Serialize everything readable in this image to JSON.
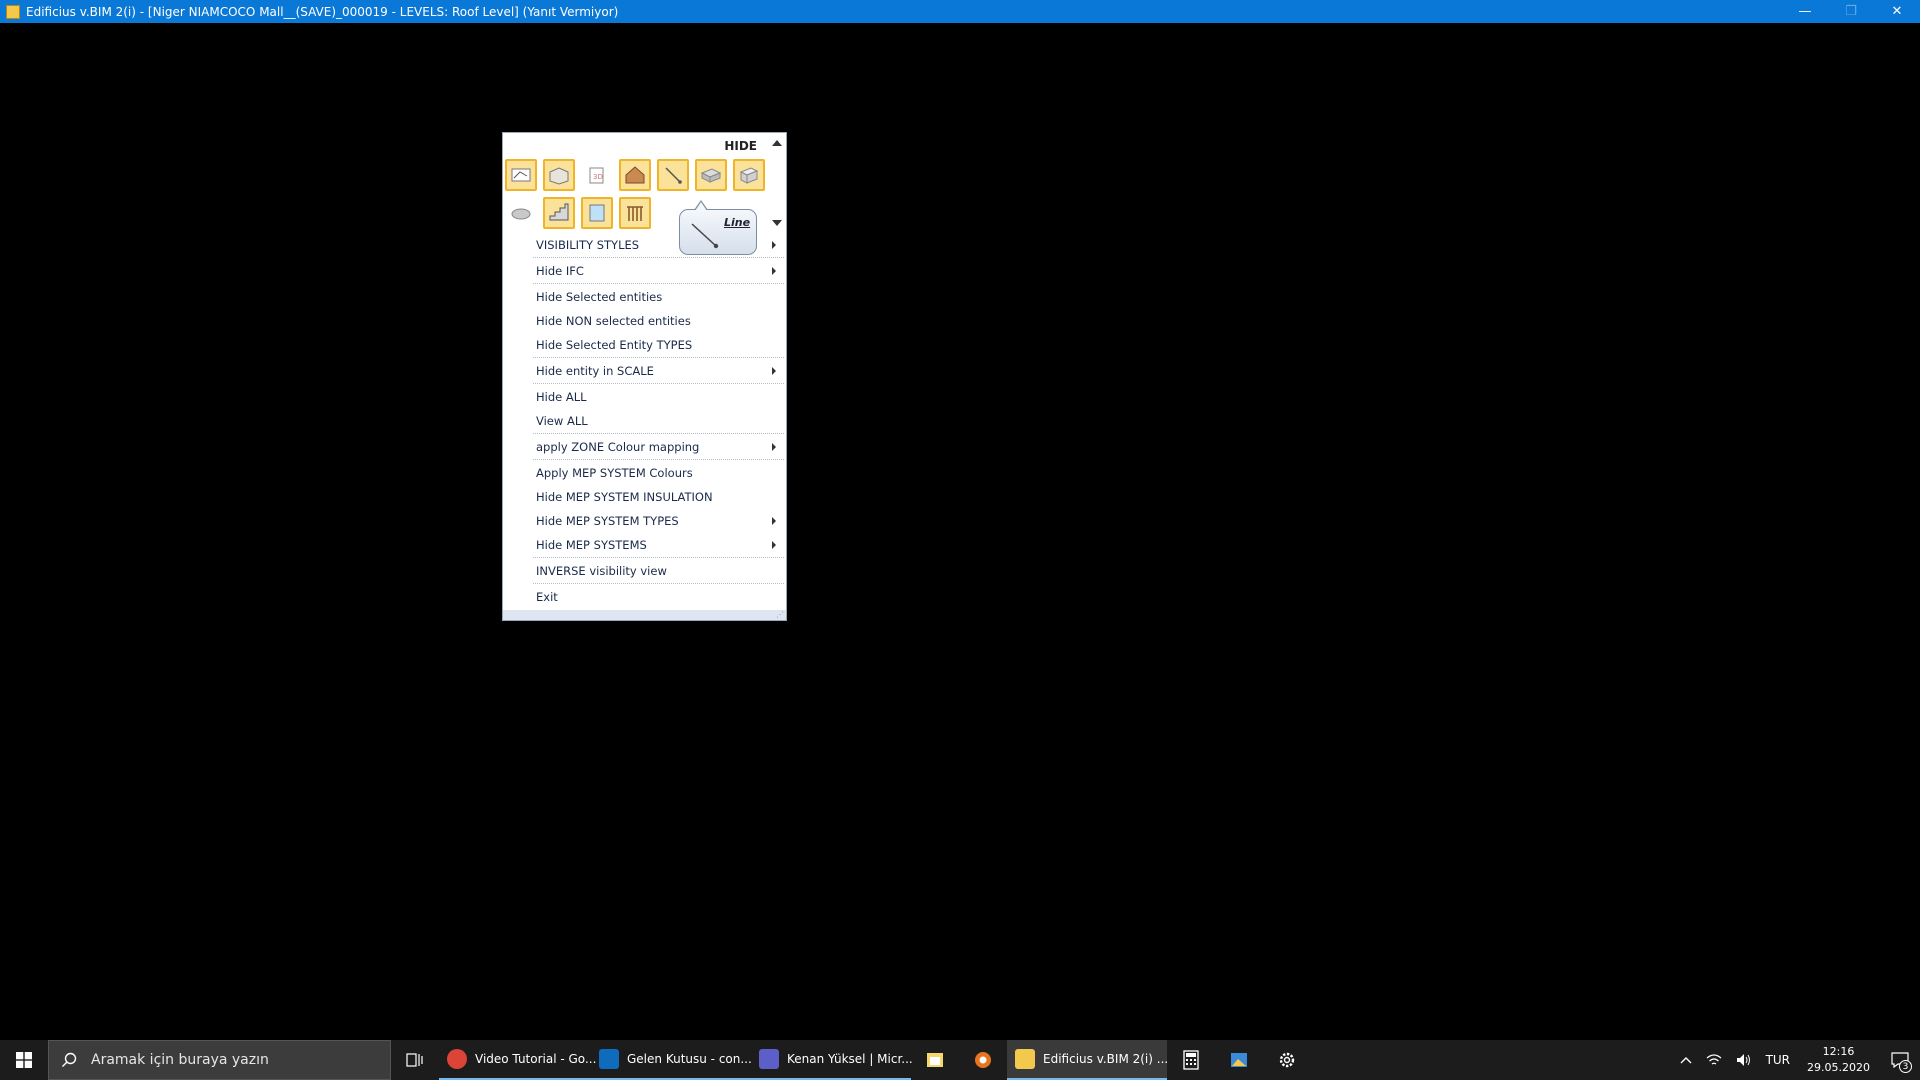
{
  "window": {
    "title": "Edificius v.BIM 2(i) - [Niger NIAMCOCO Mall__(SAVE)_000019 -  LEVELS: Roof Level] (Yanıt Vermiyor)",
    "minimize_glyph": "—",
    "restore_glyph": "❐",
    "close_glyph": "✕"
  },
  "menu": {
    "header": "HIDE",
    "tooltip": "Line",
    "tools_row1": [
      "hide-2d-icon",
      "hide-floor-icon",
      "hide-3d-icon",
      "hide-roof-icon",
      "line-icon",
      "hide-slab-icon",
      "hide-wall-icon"
    ],
    "tools_row2": [
      "hide-cloud-icon",
      "hide-stair-icon",
      "hide-window-icon",
      "hide-railing-icon"
    ],
    "items": [
      {
        "label": "VISIBILITY STYLES",
        "submenu": true
      },
      {
        "label": "Hide IFC",
        "submenu": true
      },
      {
        "label": "Hide Selected entities",
        "submenu": false
      },
      {
        "label": "Hide NON selected entities",
        "submenu": false
      },
      {
        "label": "Hide Selected Entity TYPES",
        "submenu": false
      },
      {
        "label": "Hide entity in SCALE",
        "submenu": true
      },
      {
        "label": "Hide ALL",
        "submenu": false
      },
      {
        "label": "View ALL",
        "submenu": false
      },
      {
        "label": "apply ZONE Colour mapping",
        "submenu": true
      },
      {
        "label": "Apply MEP SYSTEM Colours",
        "submenu": false
      },
      {
        "label": "Hide MEP SYSTEM INSULATION",
        "submenu": false
      },
      {
        "label": "Hide MEP SYSTEM TYPES",
        "submenu": true
      },
      {
        "label": "Hide MEP SYSTEMS",
        "submenu": true
      },
      {
        "label": "INVERSE visibility view",
        "submenu": false
      },
      {
        "label": "Exit",
        "submenu": false
      }
    ]
  },
  "taskbar": {
    "search_placeholder": "Aramak için buraya yazın",
    "apps": [
      {
        "label": "Video Tutorial - Go...",
        "color": "#db4437"
      },
      {
        "label": "Gelen Kutusu - con...",
        "color": "#0f6cbd"
      },
      {
        "label": "Kenan Yüksel | Micr...",
        "color": "#5b5fc7"
      },
      {
        "label": "Edificius v.BIM 2(i) ...",
        "color": "#f2c94c"
      }
    ],
    "language": "TUR",
    "time": "12:16",
    "date": "29.05.2020",
    "notifications": "3"
  }
}
